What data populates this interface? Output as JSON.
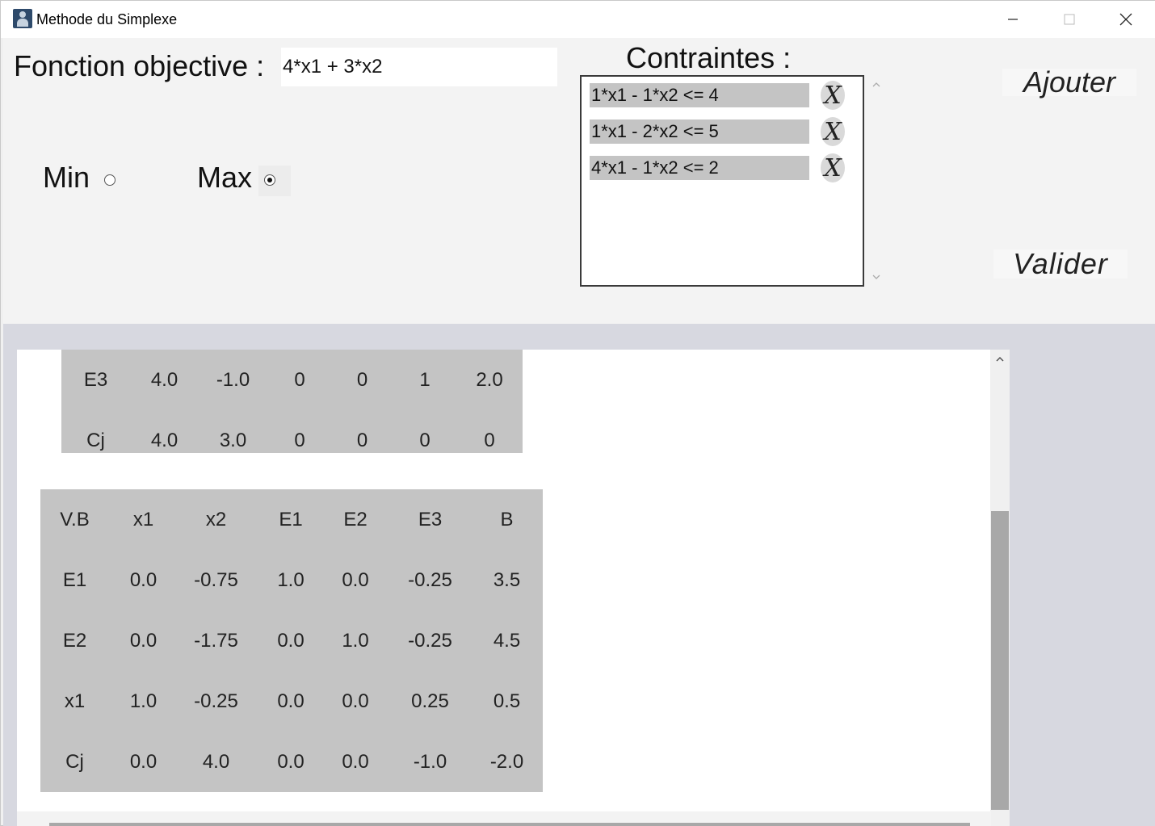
{
  "window": {
    "title": "Methode du Simplexe"
  },
  "objective": {
    "label": "Fonction objective :",
    "value": "4*x1 + 3*x2"
  },
  "mode": {
    "min_label": "Min",
    "max_label": "Max",
    "selected": "Max"
  },
  "constraints": {
    "label": "Contraintes :",
    "items": [
      {
        "text": "1*x1 - 1*x2 <= 4",
        "delete_label": "X"
      },
      {
        "text": "1*x1 - 2*x2 <= 5",
        "delete_label": "X"
      },
      {
        "text": "4*x1 - 1*x2 <= 2",
        "delete_label": "X"
      }
    ]
  },
  "buttons": {
    "add_label": "Ajouter",
    "validate_label": "Valider"
  },
  "tableaux": [
    {
      "rows": [
        [
          "E3",
          "4.0",
          "-1.0",
          "0",
          "0",
          "1",
          "2.0"
        ],
        [
          "Cj",
          "4.0",
          "3.0",
          "0",
          "0",
          "0",
          "0"
        ]
      ]
    },
    {
      "rows": [
        [
          "V.B",
          "x1",
          "x2",
          "E1",
          "E2",
          "E3",
          "B"
        ],
        [
          "E1",
          "0.0",
          "-0.75",
          "1.0",
          "0.0",
          "-0.25",
          "3.5"
        ],
        [
          "E2",
          "0.0",
          "-1.75",
          "0.0",
          "1.0",
          "-0.25",
          "4.5"
        ],
        [
          "x1",
          "1.0",
          "-0.25",
          "0.0",
          "0.0",
          "0.25",
          "0.5"
        ],
        [
          "Cj",
          "0.0",
          "4.0",
          "0.0",
          "0.0",
          "-1.0",
          "-2.0"
        ]
      ]
    }
  ]
}
